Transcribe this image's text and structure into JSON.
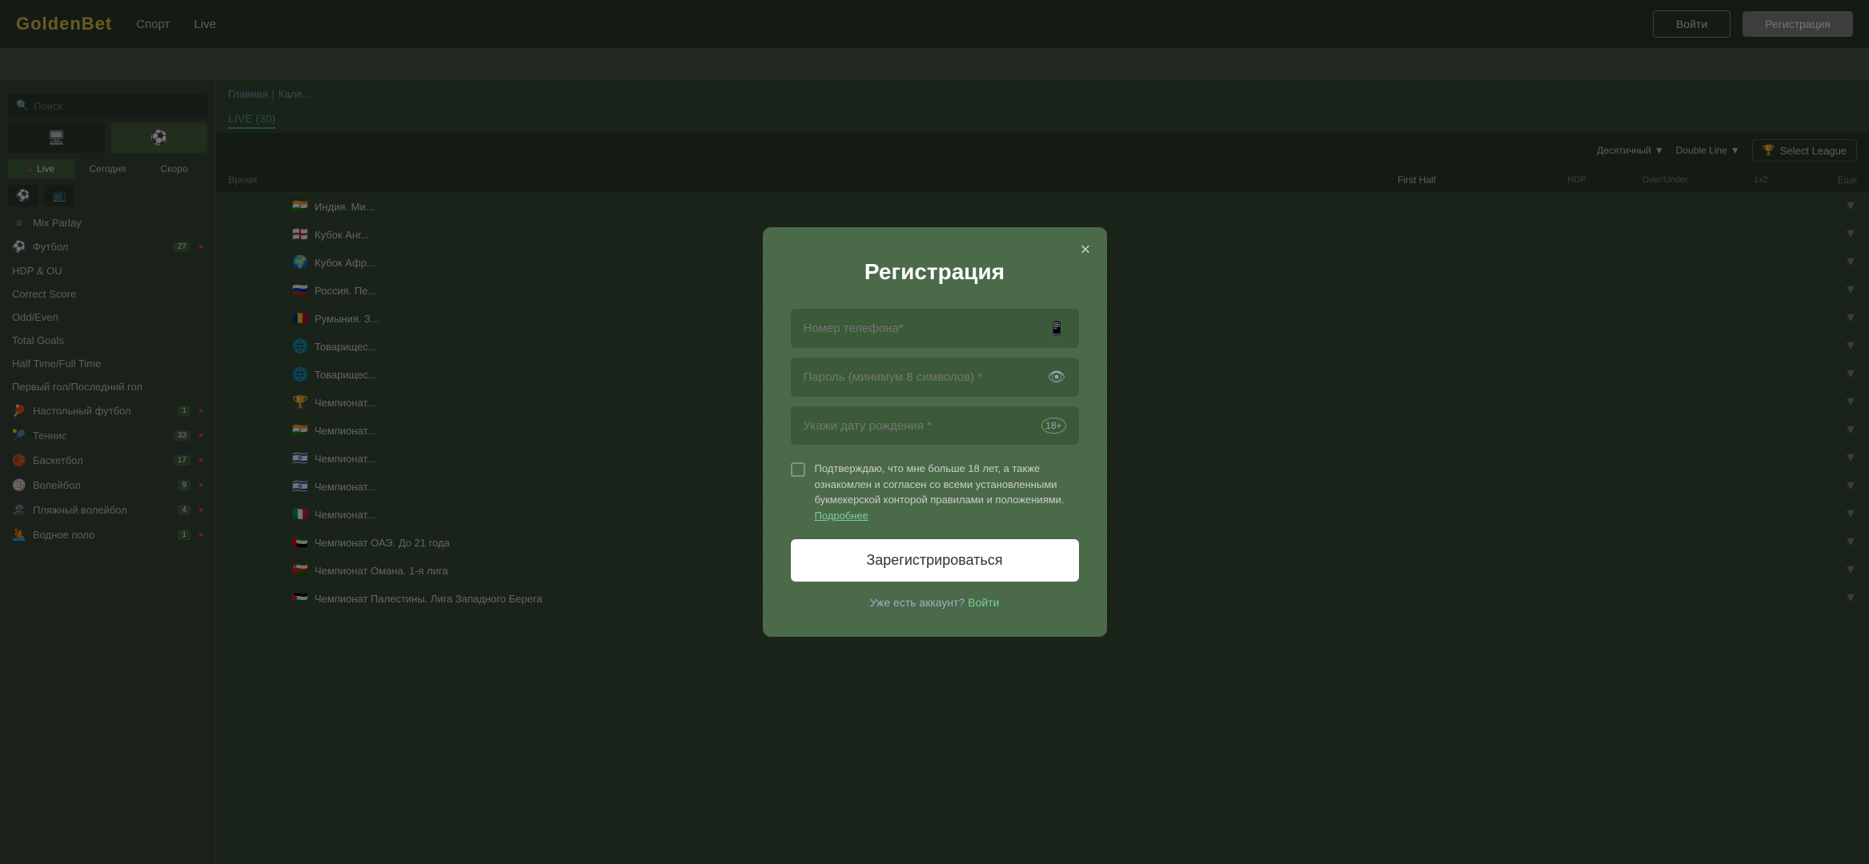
{
  "brand": {
    "name": "GoldenBet"
  },
  "header": {
    "nav": [
      {
        "label": "Спорт",
        "active": false
      },
      {
        "label": "Live",
        "active": false
      }
    ],
    "login_label": "Войти",
    "register_label": "Регистрация"
  },
  "sidebar": {
    "search_placeholder": "Поиск",
    "tabs": [
      {
        "icon": "🖥",
        "active": false
      },
      {
        "icon": "⚽",
        "active": true
      }
    ],
    "live_tabs": [
      {
        "label": "Live",
        "active": true
      },
      {
        "label": "Сегодня",
        "active": false
      },
      {
        "label": "Скоро",
        "active": false
      }
    ],
    "section_labels": {
      "mix_parlay": "Mix Parlay",
      "hdp_ou": "HDP & OU",
      "correct_score": "Correct Score",
      "odd_even": "Odd/Even",
      "total_goals": "Total Goals",
      "half_time_full_time": "Half Time/Full Time",
      "first_last_goal": "Первый гол/Последний гол"
    },
    "sports": [
      {
        "icon": "⚽",
        "label": "Футбол",
        "count": "27",
        "live": true
      },
      {
        "icon": "🏓",
        "label": "Настольный футбол",
        "count": "1",
        "live": true
      },
      {
        "icon": "🎾",
        "label": "Теннис",
        "count": "33",
        "live": true
      },
      {
        "icon": "🏀",
        "label": "Баскетбол",
        "count": "17",
        "live": true
      },
      {
        "icon": "🏐",
        "label": "Волейбол",
        "count": "9",
        "live": true
      },
      {
        "icon": "🏖",
        "label": "Пляжный волейбол",
        "count": "4",
        "live": true
      },
      {
        "icon": "🤽",
        "label": "Водное поло",
        "count": "1",
        "live": true
      }
    ]
  },
  "content": {
    "breadcrumb": [
      "Главная",
      "Кале..."
    ],
    "live_tab": "LIVE (30)",
    "header_dropdowns": [
      "Десятичный",
      "Double Line"
    ],
    "select_league_label": "Select League",
    "table_headers": {
      "time": "Время",
      "first_half": "First Half",
      "hdp": "HDP",
      "over_under": "Over/Under",
      "x12": "1x2",
      "more": "Еще"
    },
    "matches": [
      {
        "flag": "🇮🇳",
        "time": "",
        "name": "Индия. Ми...",
        "expand": true
      },
      {
        "flag": "🏴",
        "time": "",
        "name": "Кубок Анг...",
        "expand": true
      },
      {
        "flag": "🌍",
        "time": "",
        "name": "Кубок Афр...",
        "expand": true
      },
      {
        "flag": "🇷🇺",
        "time": "",
        "name": "Россия. Пе...",
        "expand": true
      },
      {
        "flag": "🇷🇴",
        "time": "",
        "name": "Румыния. З...",
        "expand": true
      },
      {
        "flag": "🌐",
        "time": "",
        "name": "Товарищес...",
        "expand": true
      },
      {
        "flag": "🌐",
        "time": "",
        "name": "Товарищес...",
        "expand": true
      },
      {
        "flag": "🏆",
        "time": "",
        "name": "Чемпионат...",
        "expand": true
      },
      {
        "flag": "🇮🇳",
        "time": "",
        "name": "Чемпионат...",
        "expand": true
      },
      {
        "flag": "🇮🇱",
        "time": "",
        "name": "Чемпионат...",
        "expand": true
      },
      {
        "flag": "🇮🇱",
        "time": "",
        "name": "Чемпионат...",
        "expand": true
      },
      {
        "flag": "🇮🇹",
        "time": "",
        "name": "Чемпионат...",
        "expand": true
      },
      {
        "flag": "🇦🇪",
        "time": "",
        "name": "Чемпионат ОАЭ. До 21 года",
        "expand": true
      },
      {
        "flag": "🇴🇲",
        "time": "",
        "name": "Чемпионат Омана. 1-я лига",
        "expand": true
      },
      {
        "flag": "🇵🇸",
        "time": "",
        "name": "Чемпионат Палестины. Лига Западного Берега",
        "expand": true
      }
    ]
  },
  "modal": {
    "title": "Регистрация",
    "close_label": "×",
    "phone_placeholder": "Номер телефона*",
    "password_placeholder": "Пароль (минимум 8 символов) *",
    "dob_placeholder": "Укажи дату рождения *",
    "checkbox_text": "Подтверждаю, что мне больше 18 лет, а также ознакомлен и согласен со всеми установленными букмекерской конторой правилами и положениями.",
    "checkbox_link": "Подробнее",
    "register_btn": "Зарегистрироваться",
    "already_account": "Уже есть аккаунт?",
    "login_link": "Войти"
  },
  "right_panel": {
    "select_league": "Select League"
  }
}
